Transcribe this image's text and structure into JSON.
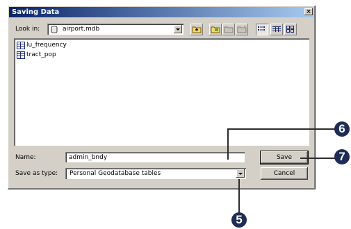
{
  "dialog": {
    "title": "Saving Data",
    "close_glyph": "×"
  },
  "look_in": {
    "label": "Look in:",
    "value": "airport.mdb",
    "icon": "database-icon"
  },
  "toolbar": {
    "buttons": [
      "up-folder-icon",
      "connect-folder-icon",
      "disconnect-folder-icon",
      "new-folder-icon",
      "list-view-icon",
      "details-view-icon",
      "thumbnails-view-icon"
    ]
  },
  "files": [
    {
      "name": "lu_frequency",
      "icon": "table-icon"
    },
    {
      "name": "tract_pop",
      "icon": "table-icon"
    }
  ],
  "name_field": {
    "label": "Name:",
    "value": "admin_bndy"
  },
  "save_type": {
    "label": "Save as type:",
    "value": "Personal Geodatabase tables"
  },
  "buttons": {
    "save": "Save",
    "cancel": "Cancel"
  },
  "callouts": {
    "step_name": "6",
    "step_save": "7",
    "step_type": "5",
    "color": "#1f2d56"
  }
}
